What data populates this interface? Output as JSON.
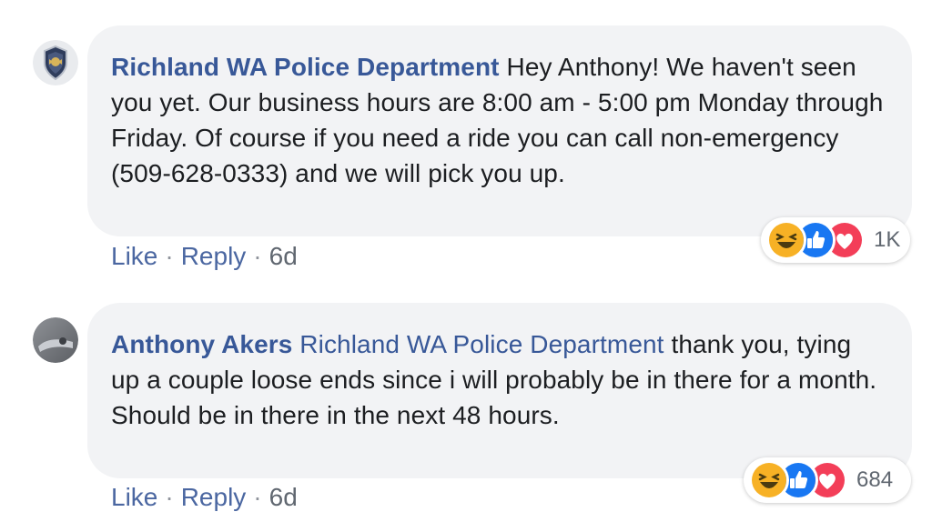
{
  "comments": [
    {
      "author": "Richland WA Police Department",
      "mention": "",
      "text": "Hey Anthony! We haven't seen you yet. Our business hours are 8:00 am - 5:00 pm Monday through Friday. Of course if you need a ride you can call non-emergency (509-628-0333) and we will pick you up.",
      "like_label": "Like",
      "reply_label": "Reply",
      "separator": "·",
      "timestamp": "6d",
      "reactions": [
        "haha-icon",
        "like-icon",
        "love-icon"
      ],
      "reaction_count": "1K"
    },
    {
      "author": "Anthony Akers",
      "mention": "Richland WA Police Department",
      "text": "thank you, tying up a couple loose ends since i will probably be in there for a month. Should be in there in the next 48 hours.",
      "like_label": "Like",
      "reply_label": "Reply",
      "separator": "·",
      "timestamp": "6d",
      "reactions": [
        "haha-icon",
        "like-icon",
        "love-icon"
      ],
      "reaction_count": "684"
    }
  ],
  "colors": {
    "bubble": "#f2f3f5",
    "link": "#385898",
    "meta": "#606770",
    "like": "#1877f2",
    "love": "#f33e58",
    "haha": "#f7b125"
  }
}
